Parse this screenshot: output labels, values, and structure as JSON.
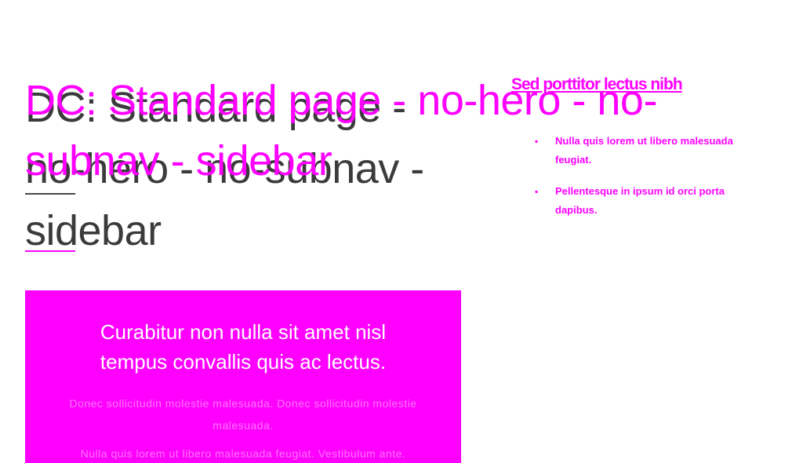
{
  "theme": {
    "accent": "#ff00ff",
    "ghost": "#1a1a1a",
    "background": "#ffffff"
  },
  "page": {
    "title": "DC: Standard page - no-hero - no-subnav - sidebar",
    "title_ghost": "DC: Standard page - no-hero - no-subnav - sidebar"
  },
  "sidebar": {
    "heading": "Sed porttitor lectus nibh",
    "heading_ghost": "Sed porttitor lectus nibh",
    "items": [
      {
        "text": "Nulla quis lorem ut libero malesuada feugiat."
      },
      {
        "text": "Pellentesque in ipsum id orci porta dapibus."
      }
    ]
  },
  "callout": {
    "heading": "Curabitur non nulla sit amet nisl tempus convallis quis ac lectus.",
    "paragraph_1": "Donec sollicitudin molestie malesuada. Donec sollicitudin molestie malesuada.",
    "paragraph_2": "Nulla quis lorem ut libero malesuada feugiat. Vestibulum ante."
  }
}
